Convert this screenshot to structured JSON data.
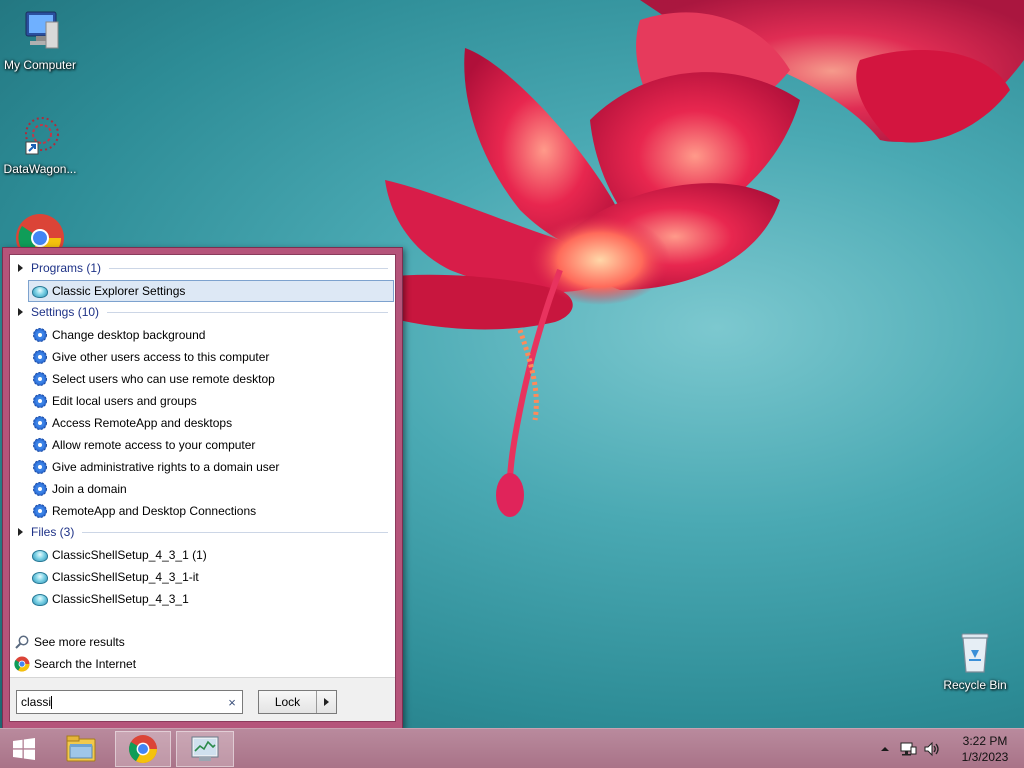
{
  "desktop": {
    "icons": [
      {
        "label": "My Computer",
        "icon": "computer-icon"
      },
      {
        "label": "DataWagon...",
        "icon": "datawagon-shortcut-icon"
      },
      {
        "label": "",
        "icon": "chrome-icon"
      },
      {
        "label": "Recycle Bin",
        "icon": "recycle-bin-icon"
      }
    ]
  },
  "start_menu": {
    "groups": {
      "programs": {
        "label": "Programs (1)",
        "items": [
          "Classic Explorer Settings"
        ]
      },
      "settings": {
        "label": "Settings (10)",
        "items": [
          "Change desktop background",
          "Give other users access to this computer",
          "Select users who can use remote desktop",
          "Edit local users and groups",
          "Access RemoteApp and desktops",
          "Allow remote access to your computer",
          "Give administrative rights to a domain user",
          "Join a domain",
          "RemoteApp and Desktop Connections"
        ]
      },
      "files": {
        "label": "Files (3)",
        "items": [
          "ClassicShellSetup_4_3_1 (1)",
          "ClassicShellSetup_4_3_1-it",
          "ClassicShellSetup_4_3_1"
        ]
      }
    },
    "see_more": "See more results",
    "search_internet": "Search the Internet",
    "search_value": "classi",
    "clear_glyph": "×",
    "lock_label": "Lock"
  },
  "taskbar": {
    "buttons": [
      "start-icon",
      "file-explorer-icon",
      "chrome-icon",
      "task-manager-icon"
    ],
    "tray": [
      "show-hidden-icons-icon",
      "network-icon",
      "volume-icon"
    ],
    "time": "3:22 PM",
    "date": "1/3/2023"
  },
  "colors": {
    "menu_frame": "#b5547a",
    "taskbar": "#a97388",
    "selection": "#dde8f5",
    "group_header": "#1e3287"
  }
}
